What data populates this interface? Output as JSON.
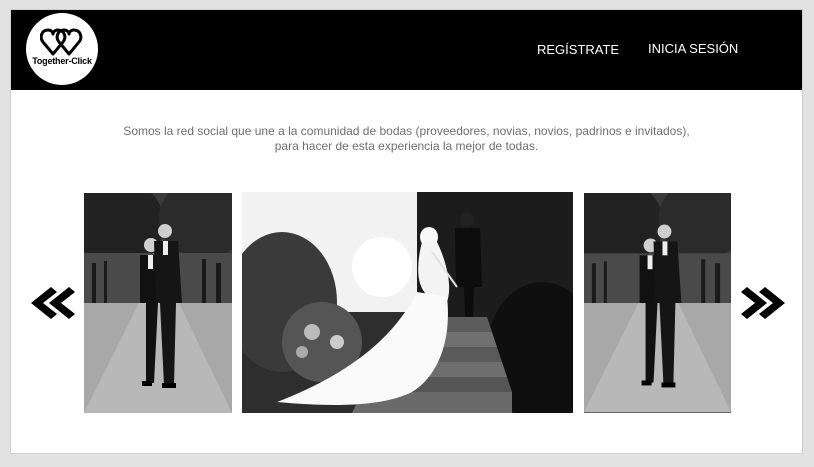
{
  "header": {
    "logo_text": "Together-Click",
    "nav": {
      "register_label": "REGÍSTRATE",
      "login_label": "INICIA SESIÓN"
    }
  },
  "intro": {
    "line1": "Somos la red social que une a la comunidad de bodas (proveedores, novias, novios, padrinos e invitados),",
    "line2": "para hacer de esta experiencia la mejor de todas."
  },
  "carousel": {
    "prev_icon": "double-chevron-left-icon",
    "next_icon": "double-chevron-right-icon",
    "slides": [
      {
        "name": "grooms-photo"
      },
      {
        "name": "bride-groom-stairs-photo"
      },
      {
        "name": "grooms-photo"
      }
    ]
  },
  "colors": {
    "header_bg": "#000000",
    "page_bg": "#ffffff",
    "intro_text": "#6f6f6f"
  }
}
